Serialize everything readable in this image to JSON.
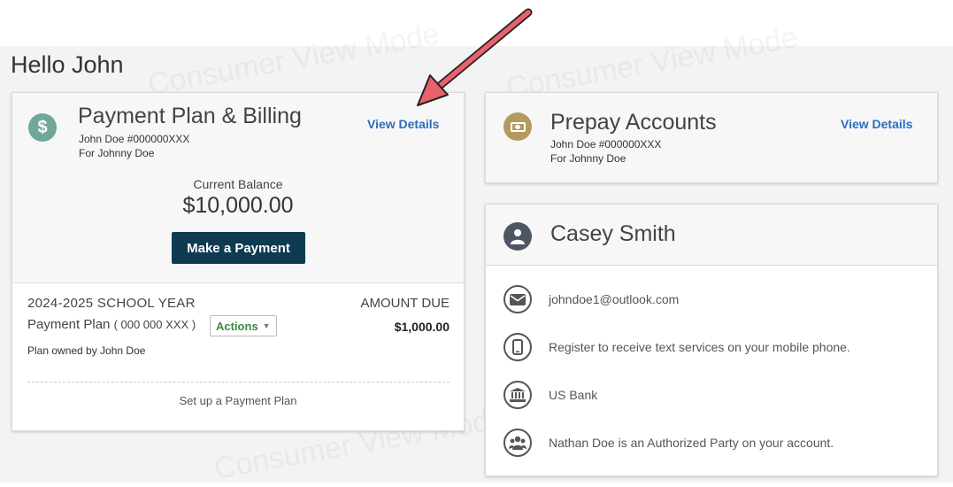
{
  "watermark": {
    "text": "Consumer View Mode"
  },
  "greeting": "Hello John",
  "billing": {
    "title": "Payment Plan & Billing",
    "view_details": "View Details",
    "account": "John Doe #000000XXX",
    "for": "For Johnny Doe",
    "balance_label": "Current Balance",
    "balance_value": "$10,000.00",
    "pay_button": "Make a Payment",
    "school_year": "2024-2025 SCHOOL YEAR",
    "amount_due_label": "AMOUNT DUE",
    "plan_label": "Payment Plan",
    "plan_number": "( 000 000 XXX )",
    "actions_label": "Actions",
    "amount_due_value": "$1,000.00",
    "plan_owner": "Plan owned by John Doe",
    "setup_link": "Set up a Payment Plan"
  },
  "prepay": {
    "title": "Prepay Accounts",
    "view_details": "View Details",
    "account": "John Doe #000000XXX",
    "for": "For Johnny Doe"
  },
  "profile": {
    "name": "Casey Smith",
    "email": "johndoe1@outlook.com",
    "text_services": "Register to receive text services on your mobile phone.",
    "bank": "US Bank",
    "authorized": "Nathan Doe  is an Authorized Party on your account."
  },
  "colors": {
    "link_blue": "#2a6ebb",
    "button_navy": "#0e3a52",
    "billing_icon": "#6fa89a",
    "prepay_icon": "#b49a5f",
    "profile_icon": "#4d5763",
    "actions_green": "#3c8a3c",
    "arrow_red": "#e8616d"
  },
  "icons": {
    "billing": "dollar-icon",
    "prepay": "money-bill-icon",
    "profile": "user-icon",
    "email": "envelope-icon",
    "phone": "mobile-phone-icon",
    "bank": "bank-icon",
    "authorized": "users-group-icon",
    "annotation": "arrow-annotation"
  }
}
